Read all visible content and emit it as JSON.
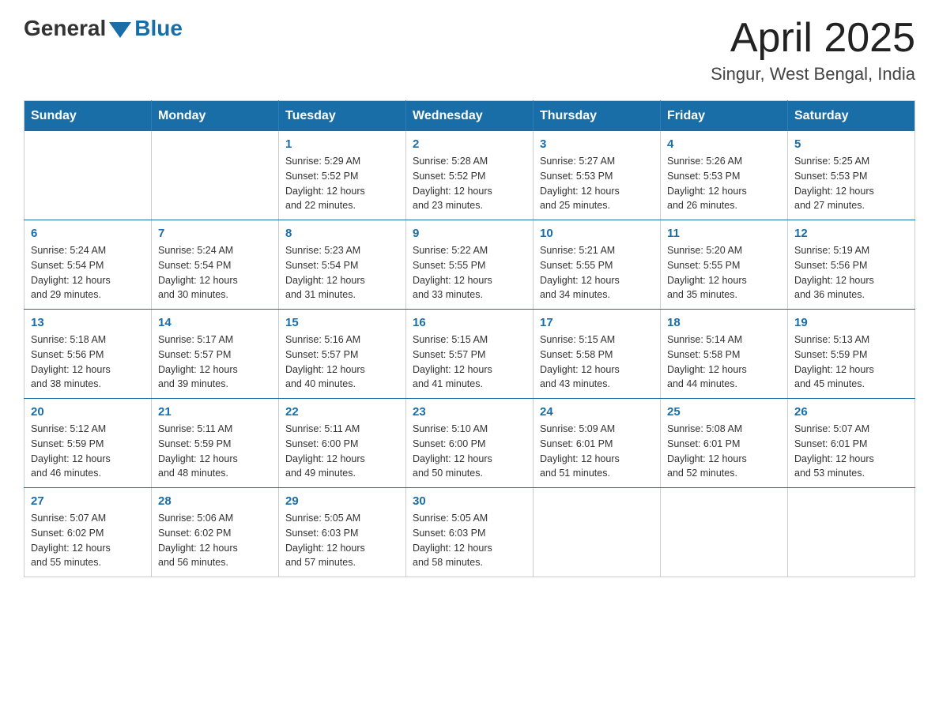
{
  "header": {
    "logo": {
      "general": "General",
      "blue": "Blue"
    },
    "title": "April 2025",
    "location": "Singur, West Bengal, India"
  },
  "weekdays": [
    "Sunday",
    "Monday",
    "Tuesday",
    "Wednesday",
    "Thursday",
    "Friday",
    "Saturday"
  ],
  "weeks": [
    [
      {
        "day": "",
        "info": ""
      },
      {
        "day": "",
        "info": ""
      },
      {
        "day": "1",
        "info": "Sunrise: 5:29 AM\nSunset: 5:52 PM\nDaylight: 12 hours\nand 22 minutes."
      },
      {
        "day": "2",
        "info": "Sunrise: 5:28 AM\nSunset: 5:52 PM\nDaylight: 12 hours\nand 23 minutes."
      },
      {
        "day": "3",
        "info": "Sunrise: 5:27 AM\nSunset: 5:53 PM\nDaylight: 12 hours\nand 25 minutes."
      },
      {
        "day": "4",
        "info": "Sunrise: 5:26 AM\nSunset: 5:53 PM\nDaylight: 12 hours\nand 26 minutes."
      },
      {
        "day": "5",
        "info": "Sunrise: 5:25 AM\nSunset: 5:53 PM\nDaylight: 12 hours\nand 27 minutes."
      }
    ],
    [
      {
        "day": "6",
        "info": "Sunrise: 5:24 AM\nSunset: 5:54 PM\nDaylight: 12 hours\nand 29 minutes."
      },
      {
        "day": "7",
        "info": "Sunrise: 5:24 AM\nSunset: 5:54 PM\nDaylight: 12 hours\nand 30 minutes."
      },
      {
        "day": "8",
        "info": "Sunrise: 5:23 AM\nSunset: 5:54 PM\nDaylight: 12 hours\nand 31 minutes."
      },
      {
        "day": "9",
        "info": "Sunrise: 5:22 AM\nSunset: 5:55 PM\nDaylight: 12 hours\nand 33 minutes."
      },
      {
        "day": "10",
        "info": "Sunrise: 5:21 AM\nSunset: 5:55 PM\nDaylight: 12 hours\nand 34 minutes."
      },
      {
        "day": "11",
        "info": "Sunrise: 5:20 AM\nSunset: 5:55 PM\nDaylight: 12 hours\nand 35 minutes."
      },
      {
        "day": "12",
        "info": "Sunrise: 5:19 AM\nSunset: 5:56 PM\nDaylight: 12 hours\nand 36 minutes."
      }
    ],
    [
      {
        "day": "13",
        "info": "Sunrise: 5:18 AM\nSunset: 5:56 PM\nDaylight: 12 hours\nand 38 minutes."
      },
      {
        "day": "14",
        "info": "Sunrise: 5:17 AM\nSunset: 5:57 PM\nDaylight: 12 hours\nand 39 minutes."
      },
      {
        "day": "15",
        "info": "Sunrise: 5:16 AM\nSunset: 5:57 PM\nDaylight: 12 hours\nand 40 minutes."
      },
      {
        "day": "16",
        "info": "Sunrise: 5:15 AM\nSunset: 5:57 PM\nDaylight: 12 hours\nand 41 minutes."
      },
      {
        "day": "17",
        "info": "Sunrise: 5:15 AM\nSunset: 5:58 PM\nDaylight: 12 hours\nand 43 minutes."
      },
      {
        "day": "18",
        "info": "Sunrise: 5:14 AM\nSunset: 5:58 PM\nDaylight: 12 hours\nand 44 minutes."
      },
      {
        "day": "19",
        "info": "Sunrise: 5:13 AM\nSunset: 5:59 PM\nDaylight: 12 hours\nand 45 minutes."
      }
    ],
    [
      {
        "day": "20",
        "info": "Sunrise: 5:12 AM\nSunset: 5:59 PM\nDaylight: 12 hours\nand 46 minutes."
      },
      {
        "day": "21",
        "info": "Sunrise: 5:11 AM\nSunset: 5:59 PM\nDaylight: 12 hours\nand 48 minutes."
      },
      {
        "day": "22",
        "info": "Sunrise: 5:11 AM\nSunset: 6:00 PM\nDaylight: 12 hours\nand 49 minutes."
      },
      {
        "day": "23",
        "info": "Sunrise: 5:10 AM\nSunset: 6:00 PM\nDaylight: 12 hours\nand 50 minutes."
      },
      {
        "day": "24",
        "info": "Sunrise: 5:09 AM\nSunset: 6:01 PM\nDaylight: 12 hours\nand 51 minutes."
      },
      {
        "day": "25",
        "info": "Sunrise: 5:08 AM\nSunset: 6:01 PM\nDaylight: 12 hours\nand 52 minutes."
      },
      {
        "day": "26",
        "info": "Sunrise: 5:07 AM\nSunset: 6:01 PM\nDaylight: 12 hours\nand 53 minutes."
      }
    ],
    [
      {
        "day": "27",
        "info": "Sunrise: 5:07 AM\nSunset: 6:02 PM\nDaylight: 12 hours\nand 55 minutes."
      },
      {
        "day": "28",
        "info": "Sunrise: 5:06 AM\nSunset: 6:02 PM\nDaylight: 12 hours\nand 56 minutes."
      },
      {
        "day": "29",
        "info": "Sunrise: 5:05 AM\nSunset: 6:03 PM\nDaylight: 12 hours\nand 57 minutes."
      },
      {
        "day": "30",
        "info": "Sunrise: 5:05 AM\nSunset: 6:03 PM\nDaylight: 12 hours\nand 58 minutes."
      },
      {
        "day": "",
        "info": ""
      },
      {
        "day": "",
        "info": ""
      },
      {
        "day": "",
        "info": ""
      }
    ]
  ]
}
